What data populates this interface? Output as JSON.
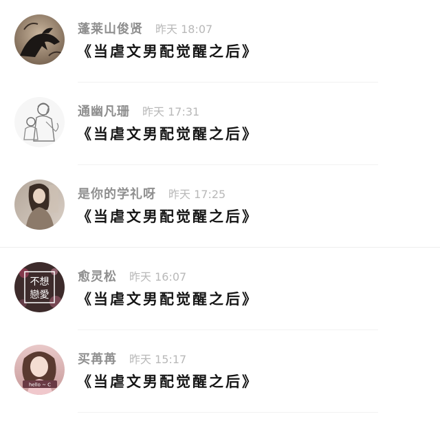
{
  "comments": [
    {
      "name": "蓬莱山俊贤",
      "time": "昨天 18:07",
      "text": "《当虐文男配觉醒之后》",
      "avatar": "crow-avatar-icon"
    },
    {
      "name": "通幽凡珊",
      "time": "昨天 17:31",
      "text": "《当虐文男配觉醒之后》",
      "avatar": "sketch-mother-child-avatar-icon"
    },
    {
      "name": "是你的学礼呀",
      "time": "昨天 17:25",
      "text": "《当虐文男配觉醒之后》",
      "avatar": "girl-photo-avatar-icon"
    },
    {
      "name": "愈灵松",
      "time": "昨天 16:07",
      "text": "《当虐文男配觉醒之后》",
      "avatar": "text-avatar-icon",
      "avatar_text": [
        "不想",
        "戀愛"
      ]
    },
    {
      "name": "买苒苒",
      "time": "昨天 15:17",
      "text": "《当虐文男配觉醒之后》",
      "avatar": "selfie-avatar-icon",
      "avatar_text": [
        "hello ~ C"
      ]
    }
  ]
}
